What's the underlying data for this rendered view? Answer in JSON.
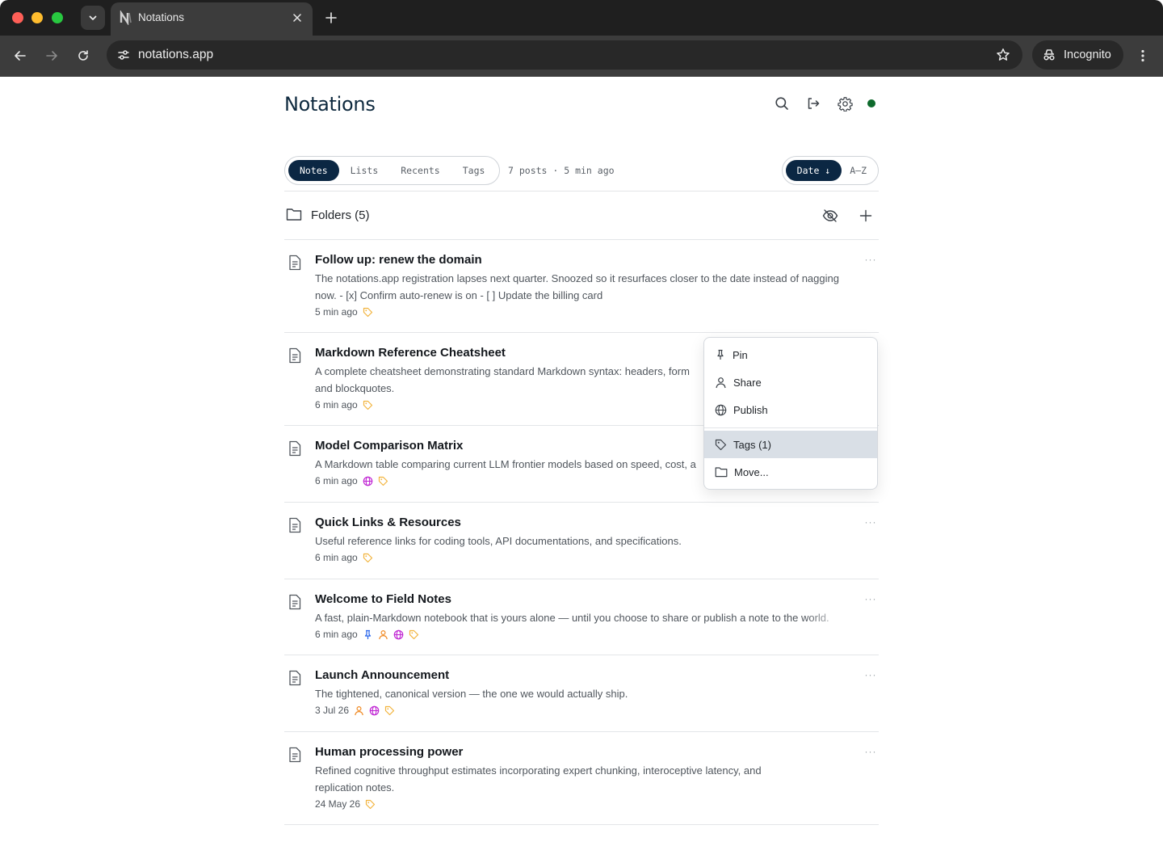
{
  "browser": {
    "tab_title": "Notations",
    "url": "notations.app",
    "incognito_label": "Incognito"
  },
  "app": {
    "logo": "Notations",
    "tabs": [
      {
        "label": "Notes",
        "active": true
      },
      {
        "label": "Lists",
        "active": false
      },
      {
        "label": "Recents",
        "active": false
      },
      {
        "label": "Tags",
        "active": false
      }
    ],
    "meta": "7 posts · 5 min ago",
    "sort": {
      "date_label": "Date ↓",
      "az_label": "A–Z"
    },
    "folders_label": "Folders (5)",
    "status_color": "#0e6a2c"
  },
  "notes": [
    {
      "title": "Follow up: renew the domain",
      "excerpt": "The notations.app registration lapses next quarter. Snoozed so it resurfaces closer to the date instead of nagging now. - [x] Confirm auto-renew is on - [ ] Update the billing card",
      "time": "5 min ago",
      "icons": [
        "tag"
      ]
    },
    {
      "title": "Markdown Reference Cheatsheet",
      "excerpt": "A complete cheatsheet demonstrating standard Markdown syntax: headers, form",
      "excerpt2": "and blockquotes.",
      "time": "6 min ago",
      "icons": [
        "tag"
      ]
    },
    {
      "title": "Model Comparison Matrix",
      "excerpt": "A Markdown table comparing current LLM frontier models based on speed, cost, a",
      "time": "6 min ago",
      "icons": [
        "globe",
        "tag"
      ]
    },
    {
      "title": "Quick Links & Resources",
      "excerpt": "Useful reference links for coding tools, API documentations, and specifications.",
      "time": "6 min ago",
      "icons": [
        "tag"
      ]
    },
    {
      "title": "Welcome to Field Notes",
      "excerpt": "A fast, plain-Markdown notebook that is yours alone — until you choose to share or publish a note to the world.",
      "time": "6 min ago",
      "icons": [
        "pin",
        "person",
        "globe",
        "tag"
      ]
    },
    {
      "title": "Launch Announcement",
      "excerpt": "The tightened, canonical version — the one we would actually ship.",
      "time": "3 Jul 26",
      "icons": [
        "person",
        "globe",
        "tag"
      ]
    },
    {
      "title": "Human processing power",
      "excerpt": "Refined cognitive throughput estimates incorporating expert chunking, interoceptive latency, and replication notes.",
      "time": "24 May 26",
      "icons": [
        "tag"
      ]
    }
  ],
  "context_menu": {
    "items": [
      {
        "label": "Pin",
        "icon": "pin-icon"
      },
      {
        "label": "Share",
        "icon": "person-icon"
      },
      {
        "label": "Publish",
        "icon": "globe-icon"
      },
      {
        "label": "Tags (1)",
        "icon": "tag-icon",
        "highlighted": true
      },
      {
        "label": "Move...",
        "icon": "folder-icon"
      }
    ]
  },
  "colors": {
    "accent": "#0b2743",
    "tag": "#f2b33d",
    "globe": "#c026d3",
    "person": "#f08a24",
    "pin": "#2563eb"
  }
}
